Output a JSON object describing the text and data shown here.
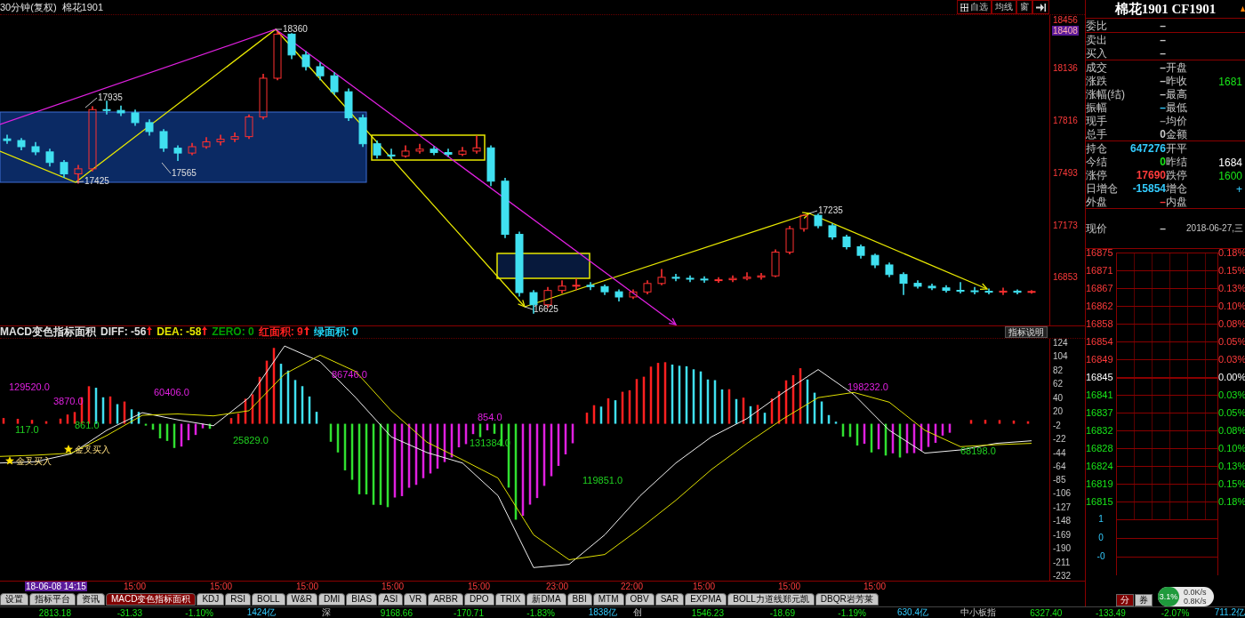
{
  "title_bar": {
    "period": "30分钟(复权)",
    "symbol": "棉花1901",
    "buttons": [
      {
        "kind": "icon-text",
        "label": "自选"
      },
      {
        "kind": "text",
        "label": "均线"
      },
      {
        "kind": "text",
        "label": "窗"
      },
      {
        "kind": "icon"
      }
    ]
  },
  "price_chart": {
    "annotations": [
      "18360",
      "17935",
      "17425",
      "17565",
      "16625",
      "17235"
    ],
    "cursor_price": "18408",
    "chart_data": {
      "type": "candlestick",
      "ylim": [
        16553,
        18461
      ],
      "yticks": [
        18456,
        18136,
        17816,
        17493,
        17173,
        16853
      ],
      "ohlc": [
        [
          17700,
          17725,
          17670,
          17690
        ],
        [
          17690,
          17705,
          17630,
          17652
        ],
        [
          17652,
          17680,
          17600,
          17620
        ],
        [
          17620,
          17640,
          17530,
          17555
        ],
        [
          17555,
          17570,
          17460,
          17485
        ],
        [
          17485,
          17540,
          17425,
          17516
        ],
        [
          17516,
          17900,
          17500,
          17880
        ],
        [
          17880,
          17935,
          17850,
          17875
        ],
        [
          17875,
          17905,
          17840,
          17860
        ],
        [
          17860,
          17880,
          17780,
          17800
        ],
        [
          17800,
          17820,
          17720,
          17745
        ],
        [
          17745,
          17760,
          17620,
          17643
        ],
        [
          17643,
          17660,
          17565,
          17613
        ],
        [
          17613,
          17675,
          17600,
          17652
        ],
        [
          17652,
          17710,
          17640,
          17682
        ],
        [
          17682,
          17725,
          17660,
          17698
        ],
        [
          17698,
          17740,
          17680,
          17714
        ],
        [
          17714,
          17850,
          17700,
          17835
        ],
        [
          17835,
          18100,
          17820,
          18073
        ],
        [
          18073,
          18360,
          18060,
          18344
        ],
        [
          18344,
          18350,
          18190,
          18216
        ],
        [
          18216,
          18240,
          18120,
          18144
        ],
        [
          18144,
          18170,
          18060,
          18088
        ],
        [
          18088,
          18110,
          17970,
          17990
        ],
        [
          17990,
          18010,
          17810,
          17830
        ],
        [
          17830,
          17850,
          17650,
          17670
        ],
        [
          17670,
          17690,
          17580,
          17601
        ],
        [
          17601,
          17640,
          17575,
          17595
        ],
        [
          17595,
          17660,
          17585,
          17625
        ],
        [
          17625,
          17670,
          17610,
          17637
        ],
        [
          17637,
          17655,
          17600,
          17616
        ],
        [
          17616,
          17640,
          17590,
          17606
        ],
        [
          17606,
          17650,
          17595,
          17625
        ],
        [
          17625,
          17720,
          17610,
          17645
        ],
        [
          17645,
          17660,
          17410,
          17440
        ],
        [
          17440,
          17460,
          17090,
          17113
        ],
        [
          17113,
          17130,
          16730,
          16755
        ],
        [
          16755,
          16770,
          16625,
          16680
        ],
        [
          16680,
          16790,
          16660,
          16768
        ],
        [
          16768,
          16830,
          16750,
          16795
        ],
        [
          16795,
          16840,
          16770,
          16800
        ],
        [
          16800,
          16820,
          16770,
          16792
        ],
        [
          16792,
          16805,
          16740,
          16760
        ],
        [
          16760,
          16775,
          16700,
          16728
        ],
        [
          16728,
          16775,
          16715,
          16759
        ],
        [
          16759,
          16830,
          16745,
          16811
        ],
        [
          16811,
          16900,
          16800,
          16849
        ],
        [
          16849,
          16870,
          16825,
          16843
        ],
        [
          16843,
          16860,
          16820,
          16838
        ],
        [
          16838,
          16855,
          16815,
          16833
        ],
        [
          16833,
          16850,
          16815,
          16834
        ],
        [
          16834,
          16860,
          16820,
          16842
        ],
        [
          16842,
          16880,
          16830,
          16850
        ],
        [
          16850,
          16875,
          16835,
          16858
        ],
        [
          16858,
          17020,
          16850,
          17004
        ],
        [
          17004,
          17165,
          16990,
          17148
        ],
        [
          17148,
          17235,
          17130,
          17230
        ],
        [
          17230,
          17240,
          17150,
          17166
        ],
        [
          17166,
          17180,
          17080,
          17097
        ],
        [
          17097,
          17110,
          17020,
          17037
        ],
        [
          17037,
          17050,
          16965,
          16984
        ],
        [
          16984,
          16995,
          16905,
          16925
        ],
        [
          16925,
          16940,
          16850,
          16866
        ],
        [
          16866,
          16880,
          16740,
          16812
        ],
        [
          16812,
          16830,
          16780,
          16794
        ],
        [
          16794,
          16810,
          16770,
          16784
        ],
        [
          16784,
          16800,
          16755,
          16769
        ],
        [
          16769,
          16820,
          16750,
          16766
        ],
        [
          16766,
          16790,
          16745,
          16763
        ],
        [
          16763,
          16780,
          16745,
          16758
        ],
        [
          16758,
          16785,
          16740,
          16764
        ],
        [
          16764,
          16775,
          16745,
          16757
        ],
        [
          16757,
          16770,
          16748,
          16762
        ]
      ]
    }
  },
  "macd": {
    "header": [
      {
        "label": "MACD变色指标面积",
        "color": "#e0e0e0",
        "rising": false
      },
      {
        "label": "DIFF: -56",
        "color": "#e0e0e0",
        "rising": true
      },
      {
        "label": "DEA: -58",
        "color": "#e6e600",
        "rising": true
      },
      {
        "label": "ZERO: 0",
        "color": "#00a000",
        "rising": false
      },
      {
        "label": "红面积: 9",
        "color": "#ff2020",
        "rising": true
      },
      {
        "label": "绿面积: 0",
        "color": "#20d0f0",
        "rising": false
      }
    ],
    "help_button": "指标说明",
    "annotations": [
      {
        "text": "129520.0",
        "color": "#e020e0"
      },
      {
        "text": "3870.0",
        "color": "#e020e0"
      },
      {
        "text": "117.0",
        "color": "#20d020"
      },
      {
        "text": "60406.0",
        "color": "#e020e0"
      },
      {
        "text": "861.0",
        "color": "#20d020"
      },
      {
        "text": "25829.0",
        "color": "#20d020"
      },
      {
        "text": "86746.0",
        "color": "#e020e0"
      },
      {
        "text": "854.0",
        "color": "#e020e0"
      },
      {
        "text": "131384.0",
        "color": "#20d020"
      },
      {
        "text": "119851.0",
        "color": "#20d020"
      },
      {
        "text": "198232.0",
        "color": "#e020e0"
      },
      {
        "text": "68198.0",
        "color": "#20d020"
      }
    ],
    "signals": [
      "金叉买入",
      "金叉买入"
    ],
    "chart_data": {
      "type": "line",
      "ylim": [
        -240,
        130
      ],
      "yticks": [
        124,
        104,
        82,
        62,
        40,
        20,
        -2,
        -22,
        -44,
        -64,
        -85,
        -106,
        -127,
        -148,
        -169,
        -190,
        -211,
        -232
      ],
      "series": [
        {
          "color": "#f0f0f0",
          "values": [
            -60,
            -58,
            -46,
            -10,
            17,
            6,
            -3,
            40,
            119,
            95,
            40,
            -20,
            -44,
            -60,
            -110,
            -220,
            -215,
            -170,
            -110,
            -60,
            -20,
            8,
            47,
            83,
            45,
            -10,
            -45,
            -40,
            -30,
            -26
          ]
        },
        {
          "color": "#e0e000",
          "values": [
            -50,
            -48,
            -45,
            -18,
            13,
            15,
            12,
            20,
            76,
            105,
            80,
            20,
            -28,
            -55,
            -83,
            -170,
            -208,
            -200,
            -160,
            -117,
            -70,
            -30,
            7,
            40,
            48,
            33,
            -10,
            -35,
            -32,
            -30
          ]
        }
      ]
    }
  },
  "time_axis": [
    {
      "kind": "cursor",
      "label": "18-06-08 14:15"
    },
    {
      "kind": "tick",
      "label": "15:00"
    },
    {
      "kind": "tick",
      "label": "15:00"
    },
    {
      "kind": "tick",
      "label": "15:00"
    },
    {
      "kind": "tick",
      "label": "15:00"
    },
    {
      "kind": "tick",
      "label": "15:00"
    },
    {
      "kind": "tick",
      "label": "23:00"
    },
    {
      "kind": "tick",
      "label": "22:00"
    },
    {
      "kind": "tick",
      "label": "15:00"
    },
    {
      "kind": "tick",
      "label": "15:00"
    },
    {
      "kind": "tick",
      "label": "15:00"
    }
  ],
  "indicator_tabs": [
    {
      "label": "设置",
      "selected": false
    },
    {
      "label": "指标平台",
      "selected": false
    },
    {
      "label": "资讯",
      "selected": false
    },
    {
      "label": "MACD变色指标面积",
      "selected": true
    },
    {
      "label": "KDJ",
      "selected": false
    },
    {
      "label": "RSI",
      "selected": false
    },
    {
      "label": "BOLL",
      "selected": false
    },
    {
      "label": "W&R",
      "selected": false
    },
    {
      "label": "DMI",
      "selected": false
    },
    {
      "label": "BIAS",
      "selected": false
    },
    {
      "label": "ASI",
      "selected": false
    },
    {
      "label": "VR",
      "selected": false
    },
    {
      "label": "ARBR",
      "selected": false
    },
    {
      "label": "DPO",
      "selected": false
    },
    {
      "label": "TRIX",
      "selected": false
    },
    {
      "label": "新DMA",
      "selected": false
    },
    {
      "label": "BBI",
      "selected": false
    },
    {
      "label": "MTM",
      "selected": false
    },
    {
      "label": "OBV",
      "selected": false
    },
    {
      "label": "SAR",
      "selected": false
    },
    {
      "label": "EXPMA",
      "selected": false
    },
    {
      "label": "BOLL力道线郑元凯",
      "selected": false
    },
    {
      "label": "DBQR岩芳莱",
      "selected": false
    }
  ],
  "quote": {
    "title": "棉花1901 CF1901",
    "groups": [
      [
        {
          "left": {
            "label": "委比",
            "value": "–",
            "color": "#c8c8c8"
          }
        }
      ],
      [
        {
          "left": {
            "label": "卖出",
            "value": "–",
            "color": "#c8c8c8"
          }
        },
        {
          "left": {
            "label": "买入",
            "value": "–",
            "color": "#c8c8c8"
          }
        }
      ],
      [
        {
          "left": {
            "label": "成交",
            "value": "–",
            "color": "#c8c8c8"
          },
          "right": {
            "label": "开盘"
          }
        },
        {
          "left": {
            "label": "涨跌",
            "value": "–",
            "color": "#c8c8c8"
          },
          "right": {
            "label": "昨收",
            "value": "1681",
            "color": "#19e619"
          }
        },
        {
          "left": {
            "label": "涨幅(结)",
            "value": "–",
            "color": "#c8c8c8"
          },
          "right": {
            "label": "最高"
          }
        },
        {
          "left": {
            "label": "振幅",
            "value": "–",
            "color": "#33ccff"
          },
          "right": {
            "label": "最低"
          }
        },
        {
          "left": {
            "label": "现手",
            "value": "–",
            "color": "#8a8a8a"
          },
          "right": {
            "label": "均价"
          }
        },
        {
          "left": {
            "label": "总手",
            "value": "0",
            "color": "#c8c8c8"
          },
          "right": {
            "label": "金额"
          }
        }
      ],
      [
        {
          "left": {
            "label": "持仓",
            "value": "647276",
            "color": "#33ccff"
          },
          "right": {
            "label": "开平"
          }
        },
        {
          "left": {
            "label": "今结",
            "value": "0",
            "color": "#19e619"
          },
          "right": {
            "label": "昨结",
            "value": "1684",
            "color": "#ffffff"
          }
        },
        {
          "left": {
            "label": "涨停",
            "value": "17690",
            "color": "#ff3b3b"
          },
          "right": {
            "label": "跌停",
            "value": "1600",
            "color": "#19e619"
          }
        },
        {
          "left": {
            "label": "日增仓",
            "value": "-15854",
            "color": "#33ccff"
          },
          "right": {
            "label": "增仓",
            "value": "+",
            "color": "#33ccff"
          }
        },
        {
          "left": {
            "label": "外盘",
            "value": "–",
            "color": "#ff3b3b"
          },
          "right": {
            "label": "内盘"
          }
        }
      ]
    ],
    "current": {
      "label": "现价",
      "value": "–",
      "date": "2018-06-27,三"
    },
    "minute_rows": [
      {
        "price": "16875",
        "pct": "0.18%",
        "color": "#ff3b3b"
      },
      {
        "price": "16871",
        "pct": "0.15%",
        "color": "#ff3b3b"
      },
      {
        "price": "16867",
        "pct": "0.13%",
        "color": "#ff3b3b"
      },
      {
        "price": "16862",
        "pct": "0.10%",
        "color": "#ff3b3b"
      },
      {
        "price": "16858",
        "pct": "0.08%",
        "color": "#ff3b3b"
      },
      {
        "price": "16854",
        "pct": "0.05%",
        "color": "#ff3b3b"
      },
      {
        "price": "16849",
        "pct": "0.03%",
        "color": "#ff3b3b"
      },
      {
        "price": "16845",
        "pct": "0.00%",
        "color": "#ffffff"
      },
      {
        "price": "16841",
        "pct": "0.03%",
        "color": "#19e619"
      },
      {
        "price": "16837",
        "pct": "0.05%",
        "color": "#19e619"
      },
      {
        "price": "16832",
        "pct": "0.08%",
        "color": "#19e619"
      },
      {
        "price": "16828",
        "pct": "0.10%",
        "color": "#19e619"
      },
      {
        "price": "16824",
        "pct": "0.13%",
        "color": "#19e619"
      },
      {
        "price": "16819",
        "pct": "0.15%",
        "color": "#19e619"
      },
      {
        "price": "16815",
        "pct": "0.18%",
        "color": "#19e619"
      }
    ],
    "volume_axis": [
      "1",
      "0",
      "-0"
    ],
    "tabs": [
      {
        "label": "分",
        "selected": true
      },
      {
        "label": "券",
        "selected": false
      }
    ]
  },
  "speed_widget": {
    "percent": "3.1%",
    "upload": "0.0K/s",
    "download": "0.8K/s"
  },
  "status_bar": [
    {
      "values": [
        "2813.18",
        "-31.33",
        "-1.10%"
      ],
      "amount": "1424亿"
    },
    {
      "label": "深",
      "values": [
        "9168.66",
        "-170.71",
        "-1.83%"
      ],
      "amount": "1838亿"
    },
    {
      "label": "创",
      "values": [
        "1546.23",
        "-18.69",
        "-1.19%"
      ],
      "amount": "630.4亿"
    },
    {
      "label": "中小板指",
      "values": [
        "6327.40",
        "-133.49",
        "-2.07%"
      ],
      "amount": "711.2亿"
    }
  ]
}
